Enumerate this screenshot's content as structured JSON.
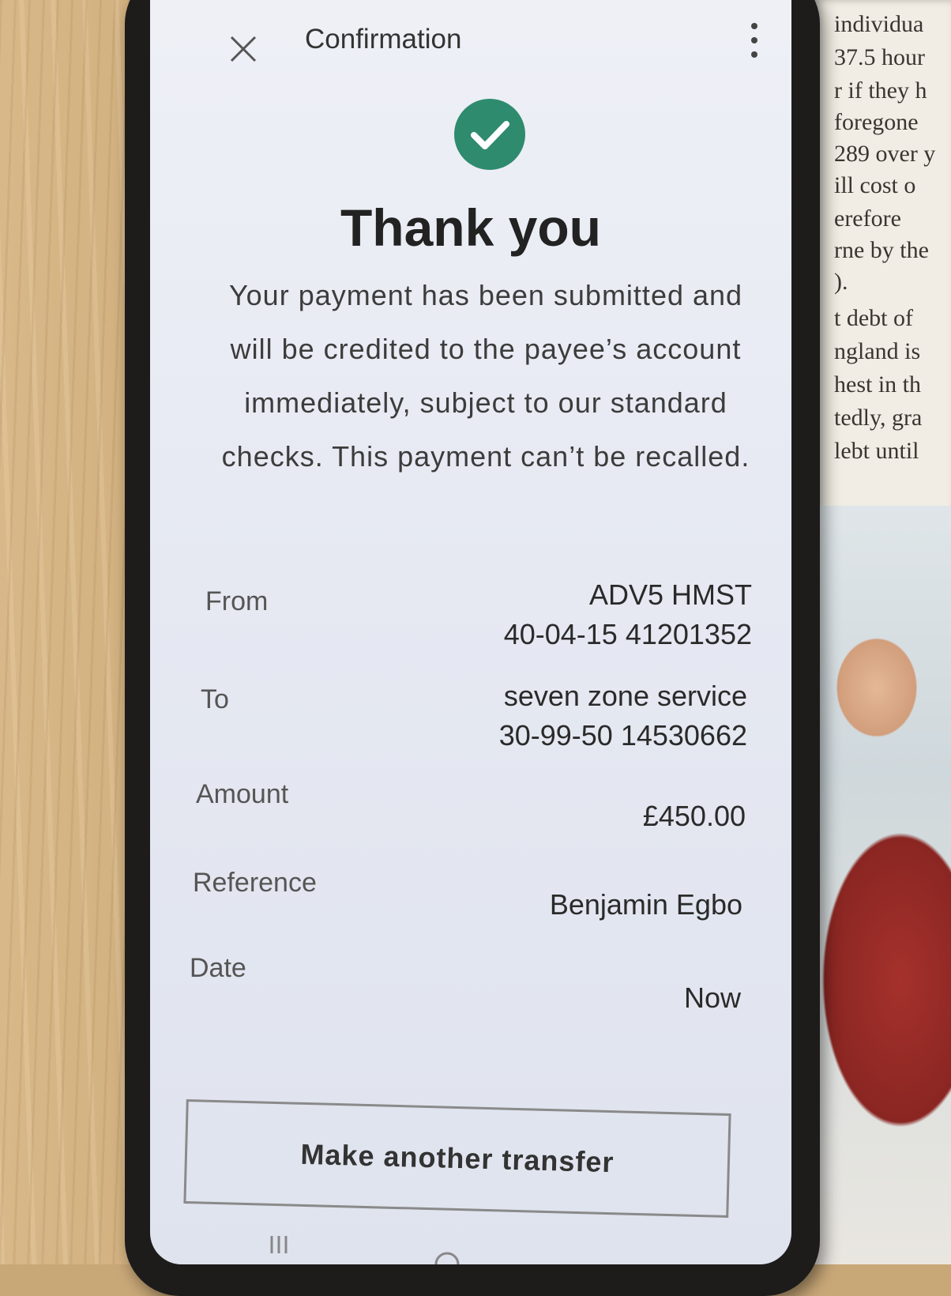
{
  "header": {
    "title": "Confirmation"
  },
  "confirmation": {
    "heading": "Thank you",
    "message": "Your payment has been submitted and will be credited to the payee’s account immediately, subject to our standard checks. This payment can’t be recalled."
  },
  "details": {
    "from": {
      "label": "From",
      "name": "ADV5 HMST",
      "account": "40-04-15 41201352"
    },
    "to": {
      "label": "To",
      "name": "seven zone service",
      "account": "30-99-50 14530662"
    },
    "amount": {
      "label": "Amount",
      "value": "£450.00"
    },
    "reference": {
      "label": "Reference",
      "value": "Benjamin Egbo"
    },
    "date": {
      "label": "Date",
      "value": "Now"
    }
  },
  "actions": {
    "make_another_transfer": "Make another transfer"
  },
  "icons": {
    "close": "close-icon",
    "menu": "more-vertical-icon",
    "success": "check-circle-icon"
  },
  "colors": {
    "success_green": "#2e8b6e",
    "screen_background": "#e6e9f2"
  },
  "book_text": [
    "individua",
    "37.5 hour",
    "r if they h",
    "foregone",
    "289 over y",
    "ill cost o",
    "erefore",
    "rne by the",
    ").",
    "t debt of",
    "ngland is",
    "hest in th",
    "tedly, gra",
    "lebt until"
  ]
}
